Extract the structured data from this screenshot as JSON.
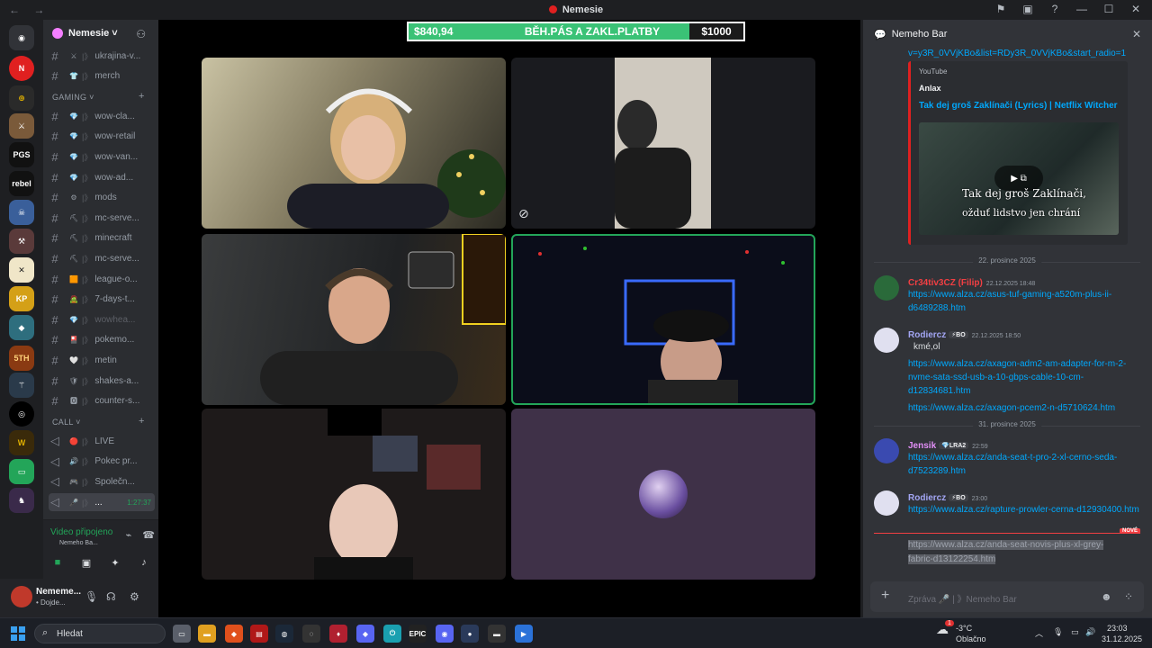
{
  "window": {
    "title": "Nemesie",
    "tools": [
      "⚑",
      "▣",
      "?",
      "—",
      "☐",
      "✕"
    ]
  },
  "server": {
    "name": "Nemesie ˅"
  },
  "channels": [
    {
      "name": "ukrajina-v...",
      "emoji": "⚔"
    },
    {
      "name": "merch",
      "emoji": "👕"
    },
    {
      "category": "GAMING ˅"
    },
    {
      "name": "wow-cla...",
      "emoji": "💎"
    },
    {
      "name": "wow-retail",
      "emoji": "💎"
    },
    {
      "name": "wow-van...",
      "emoji": "💎"
    },
    {
      "name": "wow-ad...",
      "emoji": "💎"
    },
    {
      "name": "mods",
      "emoji": "⚙"
    },
    {
      "name": "mc-serve...",
      "emoji": "⛏"
    },
    {
      "name": "minecraft",
      "emoji": "⛏"
    },
    {
      "name": "mc-serve...",
      "emoji": "⛏"
    },
    {
      "name": "league-o...",
      "emoji": "🟧"
    },
    {
      "name": "7-days-t...",
      "emoji": "🧟"
    },
    {
      "name": "wowhea...",
      "emoji": "💎",
      "muted": true
    },
    {
      "name": "pokemo...",
      "emoji": "🎴"
    },
    {
      "name": "metin",
      "emoji": "🤍"
    },
    {
      "name": "shakes-a...",
      "emoji": "🛡"
    },
    {
      "name": "counter-s...",
      "emoji": "🅾"
    },
    {
      "category": "CALL ˅"
    },
    {
      "name": "LIVE",
      "emoji": "🔴",
      "voice": true
    },
    {
      "name": "Pokec pr...",
      "emoji": "🔊",
      "voice": true
    },
    {
      "name": "Společn...",
      "emoji": "🎮",
      "voice": true
    },
    {
      "name": "...",
      "emoji": "🎤",
      "voice": true,
      "active": true,
      "timer": "1:27:37"
    }
  ],
  "voice_panel": {
    "status": "Video připojeno",
    "channel": "Nemeho Ba..."
  },
  "user_panel": {
    "name": "Nememe...",
    "status": "• Dojde..."
  },
  "stream_banner": {
    "raised": "$840,94",
    "label": "BĚH.PÁS A ZAKL.PLATBY",
    "goal": "$1000",
    "progress": 0.84
  },
  "chat": {
    "channel": "Nemeho Bar",
    "top_link": "v=y3R_0VVjKBo&list=RDy3R_0VVjKBo&start_radio=1",
    "embed": {
      "provider": "YouTube",
      "author": "Anlax",
      "title": "Tak dej groš Zaklínači (Lyrics) | Netflix Witcher",
      "subtitle_line1": "Tak dej groš Zaklínači,",
      "subtitle_line2": "ožduť lidstvo jen chrání"
    },
    "date1": "22. prosince 2025",
    "date2": "31. prosince 2025",
    "messages": [
      {
        "author": "Cr34tiv3CZ (Filip)",
        "color": "#f23f43",
        "tag": "",
        "time": "22.12.2025 18:48",
        "lines": [
          "https://www.alza.cz/asus-tuf-gaming-a520m-plus-ii-d6489288.htm"
        ]
      },
      {
        "author": "Rodiercz",
        "color": "#a3a6f4",
        "tag": "⚡BO",
        "time": "22.12.2025 18:50",
        "text": "kmé,ol",
        "lines": [
          "https://www.alza.cz/axagon-adm2-am-adapter-for-m-2-nvme-sata-ssd-usb-a-10-gbps-cable-10-cm-d12834681.htm",
          "https://www.alza.cz/axagon-pcem2-n-d5710624.htm"
        ]
      },
      {
        "author": "Jensik",
        "color": "#e28ff7",
        "tag": "💎LRA2",
        "time": "22:59",
        "lines": [
          "https://www.alza.cz/anda-seat-t-pro-2-xl-cerno-seda-d7523289.htm"
        ]
      },
      {
        "author": "Rodiercz",
        "color": "#a3a6f4",
        "tag": "⚡BO",
        "time": "23:00",
        "lines": [
          "https://www.alza.cz/rapture-prowler-cerna-d12930400.htm"
        ]
      }
    ],
    "new_label": "NOVÉ",
    "pending_link": "https://www.alza.cz/anda-seat-novis-plus-xl-grey-fabric-d13122254.htm",
    "composer_placeholder": "Zpráva 🎤 | 》Nemeho Bar"
  },
  "taskbar": {
    "search": "Hledat",
    "weather_temp": "-3°C",
    "weather_desc": "Oblačno",
    "time": "23:03",
    "date": "31.12.2025",
    "weather_badge": "1"
  }
}
